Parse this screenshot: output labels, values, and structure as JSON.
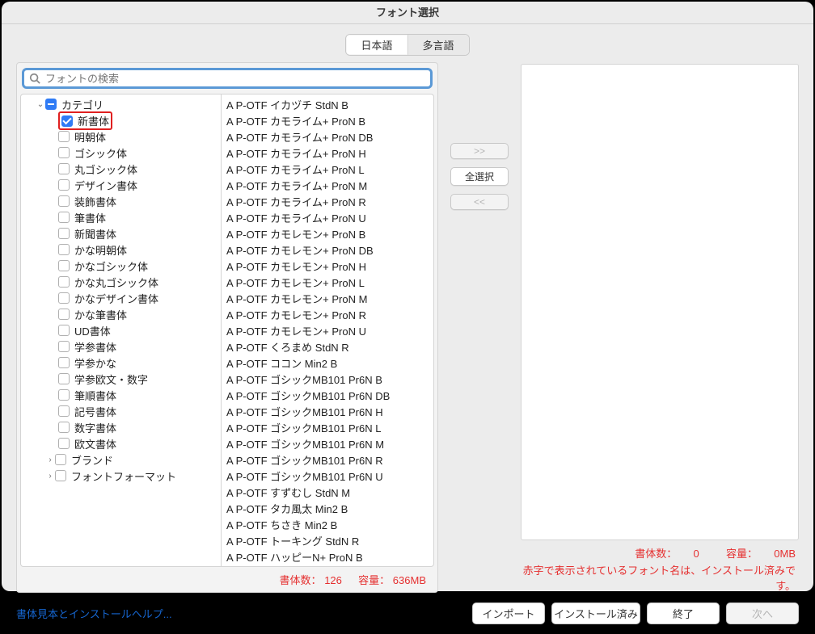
{
  "window": {
    "title": "フォント選択"
  },
  "tabs": {
    "jp": "日本語",
    "multi": "多言語",
    "active": "jp"
  },
  "search": {
    "placeholder": "フォントの検索",
    "value": ""
  },
  "tree": {
    "category_label": "カテゴリ",
    "items": [
      {
        "label": "新書体",
        "checked": true,
        "highlighted": true
      },
      {
        "label": "明朝体",
        "checked": false
      },
      {
        "label": "ゴシック体",
        "checked": false
      },
      {
        "label": "丸ゴシック体",
        "checked": false
      },
      {
        "label": "デザイン書体",
        "checked": false
      },
      {
        "label": "装飾書体",
        "checked": false
      },
      {
        "label": "筆書体",
        "checked": false
      },
      {
        "label": "新聞書体",
        "checked": false
      },
      {
        "label": "かな明朝体",
        "checked": false
      },
      {
        "label": "かなゴシック体",
        "checked": false
      },
      {
        "label": "かな丸ゴシック体",
        "checked": false
      },
      {
        "label": "かなデザイン書体",
        "checked": false
      },
      {
        "label": "かな筆書体",
        "checked": false
      },
      {
        "label": "UD書体",
        "checked": false
      },
      {
        "label": "学参書体",
        "checked": false
      },
      {
        "label": "学参かな",
        "checked": false
      },
      {
        "label": "学参欧文・数字",
        "checked": false
      },
      {
        "label": "筆順書体",
        "checked": false
      },
      {
        "label": "記号書体",
        "checked": false
      },
      {
        "label": "数字書体",
        "checked": false
      },
      {
        "label": "欧文書体",
        "checked": false
      }
    ],
    "brand_label": "ブランド",
    "format_label": "フォントフォーマット"
  },
  "fonts": [
    "A P-OTF イカヅチ StdN B",
    "A P-OTF カモライム+ ProN B",
    "A P-OTF カモライム+ ProN DB",
    "A P-OTF カモライム+ ProN H",
    "A P-OTF カモライム+ ProN L",
    "A P-OTF カモライム+ ProN M",
    "A P-OTF カモライム+ ProN R",
    "A P-OTF カモライム+ ProN U",
    "A P-OTF カモレモン+ ProN B",
    "A P-OTF カモレモン+ ProN DB",
    "A P-OTF カモレモン+ ProN H",
    "A P-OTF カモレモン+ ProN L",
    "A P-OTF カモレモン+ ProN M",
    "A P-OTF カモレモン+ ProN R",
    "A P-OTF カモレモン+ ProN U",
    "A P-OTF くろまめ StdN R",
    "A P-OTF ココン Min2 B",
    "A P-OTF ゴシックMB101 Pr6N B",
    "A P-OTF ゴシックMB101 Pr6N DB",
    "A P-OTF ゴシックMB101 Pr6N H",
    "A P-OTF ゴシックMB101 Pr6N L",
    "A P-OTF ゴシックMB101 Pr6N M",
    "A P-OTF ゴシックMB101 Pr6N R",
    "A P-OTF ゴシックMB101 Pr6N U",
    "A P-OTF すずむし StdN M",
    "A P-OTF タカ風太 Min2 B",
    "A P-OTF ちさき Min2 B",
    "A P-OTF トーキング StdN R",
    "A P-OTF ハッピーN+ ProN B"
  ],
  "left_stats": {
    "count_label": "書体数：",
    "count": "126",
    "size_label": "容量：",
    "size": "636MB"
  },
  "right_stats": {
    "count_label": "書体数：",
    "count": "0",
    "size_label": "容量：",
    "size": "0MB"
  },
  "notice": "赤字で表示されているフォント名は、インストール済みです。",
  "mid_buttons": {
    "add": ">>",
    "select_all": "全選択",
    "remove": "<<"
  },
  "footer": {
    "help": "書体見本とインストールヘルプ...",
    "import": "インポート",
    "installed": "インストール済み",
    "quit": "終了",
    "next": "次へ"
  }
}
